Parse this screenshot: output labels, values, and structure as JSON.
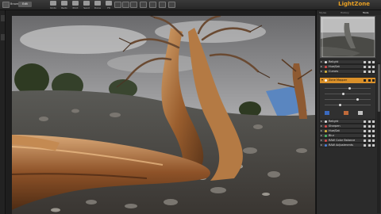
{
  "app": {
    "brand": "LightZone"
  },
  "toolbar": {
    "mode_label": "Browse",
    "edit_label": "Edit",
    "buttons": [
      "Undo",
      "Redo",
      "Print",
      "Send",
      "Done",
      "Fit",
      "Zoom"
    ]
  },
  "panel": {
    "tabs": [
      "Styles",
      "History",
      "Tools"
    ],
    "active_tab": "Tools",
    "tools": [
      {
        "label": "Relight",
        "color": "#e0e0e0"
      },
      {
        "label": "Hue/Sat",
        "color": "#d94a4a"
      },
      {
        "label": "Curves",
        "color": "#d9b53a"
      },
      {
        "label": "Sharpen",
        "color": "#4ac16a"
      },
      {
        "label": "Tone Mapper",
        "color": "#4a7fd9"
      }
    ],
    "expanded_tool": {
      "label": "Zone Mapper",
      "color": "#ffffff"
    },
    "lower_tools": [
      {
        "label": "Relight",
        "color": "#e0e0e0"
      },
      {
        "label": "Sharpen",
        "color": "#d94a4a"
      },
      {
        "label": "Hue/Sat",
        "color": "#d9b53a"
      },
      {
        "label": "Blur",
        "color": "#4ac16a"
      },
      {
        "label": "RAW Color Balance",
        "color": "#d94a4a"
      },
      {
        "label": "RAW Adjustments",
        "color": "#4a7fd9"
      }
    ]
  },
  "colors": {
    "accent": "#e8a023",
    "selected_row": "#d9902a"
  }
}
